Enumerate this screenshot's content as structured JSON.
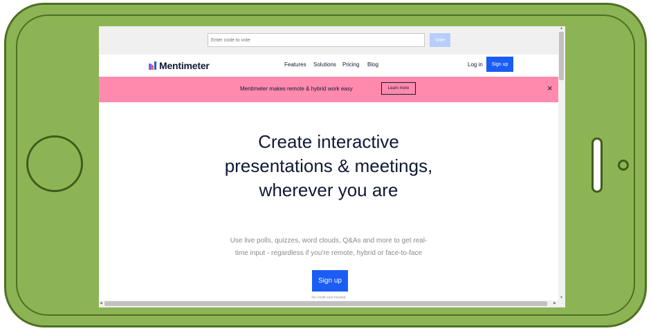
{
  "votebar": {
    "placeholder": "Enter code to vote",
    "vote_label": "Vote"
  },
  "brand": {
    "name": "Mentimeter",
    "colors": [
      "#5b6cf0",
      "#ff5c5c",
      "#1b5cf4"
    ]
  },
  "nav": {
    "links": [
      "Features",
      "Solutions",
      "Pricing",
      "Blog"
    ],
    "login_label": "Log in",
    "signup_label": "Sign up"
  },
  "banner": {
    "text": "Mentimeter makes remote & hybrid work easy",
    "learn_label": "Learn more",
    "close_icon": "×"
  },
  "hero": {
    "title_lines": [
      "Create interactive",
      "presentations & meetings,",
      "wherever you are"
    ],
    "subtitle_lines": [
      "Use live polls, quizzes, word clouds, Q&As and more to get real-",
      "time input - regardless if you're remote, hybrid or face-to-face"
    ],
    "cta_label": "Sign up",
    "note": "No credit card needed"
  },
  "scroll": {
    "up": "▲",
    "down": "▼",
    "left": "◀",
    "right": "▶"
  },
  "colors": {
    "accent": "#1b5cf4",
    "banner": "#ff8aad",
    "phone": "#8db454",
    "text": "#101834"
  }
}
